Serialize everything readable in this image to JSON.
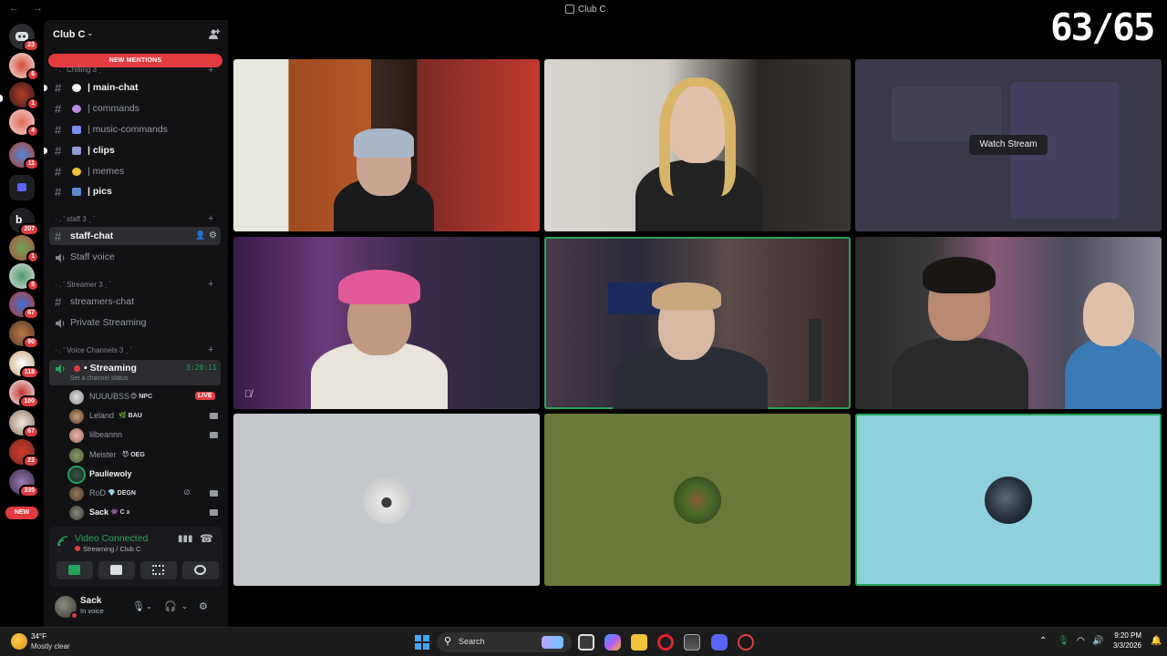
{
  "window": {
    "title": "Club C"
  },
  "overlay": {
    "counter": "63/65"
  },
  "rail": {
    "badges": [
      "23",
      "6",
      "1",
      "4",
      "11",
      "207",
      "1",
      "5",
      "67",
      "90",
      "118",
      "100",
      "67",
      "22",
      "335"
    ],
    "new_label": "NEW"
  },
  "guild": {
    "name": "Club C"
  },
  "new_mentions": "NEW MENTIONS",
  "categories": {
    "chilling": "· . ' Chilling 3 ˏ ˋ",
    "staff": "· . ' staff 3 ˏ ˋ",
    "streamer": "· . ' Streamer 3 ˏ ˋ",
    "voice": "· . ' Voice Channels 3 ˏ ˋ"
  },
  "channels": {
    "main_chat": "| main-chat",
    "commands": "| commands",
    "music_commands": "| music-commands",
    "clips": "| clips",
    "memes": "| memes",
    "pics": "| pics",
    "staff_chat": "staff-chat",
    "staff_voice": "Staff voice",
    "streamers_chat": "streamers-chat",
    "private_streaming": "Private Streaming"
  },
  "voice_channel": {
    "name": "• Streaming",
    "timer": "3:20:11",
    "status_placeholder": "Set a channel status",
    "live_color": "#e23c3f"
  },
  "voice_users": [
    {
      "name": "NUUUBSS",
      "tag": "😊 NPC",
      "live": "LIVE"
    },
    {
      "name": "Leland",
      "tag": "🌿 BAU"
    },
    {
      "name": "lilbeannn",
      "tag": ""
    },
    {
      "name": "Meister",
      "tag": "😈 OEG"
    },
    {
      "name": "Pauliewoly",
      "tag": ""
    },
    {
      "name": "RoD",
      "tag": "💎 DEGN"
    },
    {
      "name": "Sack",
      "tag": "👾 C x"
    }
  ],
  "rtc": {
    "status": "Video Connected",
    "location": "Streaming / Club C"
  },
  "user": {
    "name": "Sack",
    "status": "In voice"
  },
  "stage": {
    "watch_stream": "Watch Stream",
    "speaking_color": "#23a55a",
    "avatar_tile_colors": [
      "#c4c8cc",
      "#6b7a3a",
      "#8fd0dc"
    ]
  },
  "taskbar": {
    "temp": "34°F",
    "weather": "Mostly clear",
    "search_label": "Search",
    "time": "9:20 PM",
    "date": "3/3/2026"
  },
  "colors": {
    "accent": "#5865f2",
    "danger": "#e23c3f",
    "online": "#23a55a"
  }
}
